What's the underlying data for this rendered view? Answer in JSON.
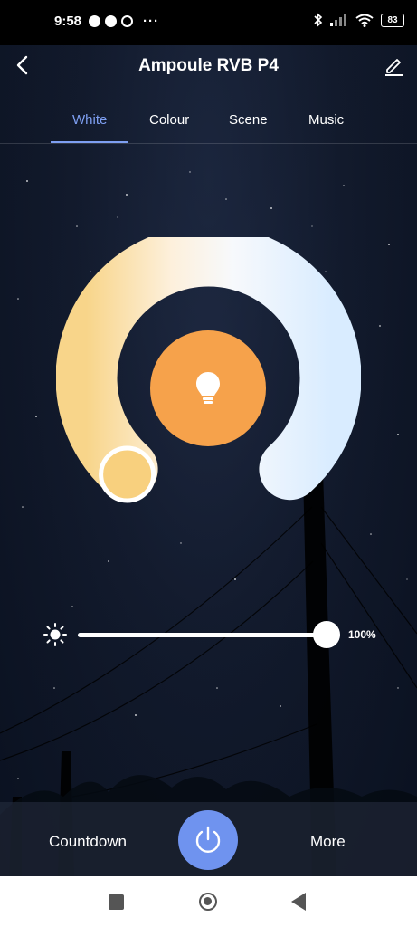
{
  "status_bar": {
    "time": "9:58",
    "overflow": "···",
    "battery": "83"
  },
  "header": {
    "title": "Ampoule RVB P4"
  },
  "tabs": [
    {
      "label": "White",
      "active": true
    },
    {
      "label": "Colour",
      "active": false
    },
    {
      "label": "Scene",
      "active": false
    },
    {
      "label": "Music",
      "active": false
    }
  ],
  "brightness": {
    "value_label": "100%",
    "level": 1.0
  },
  "bottom": {
    "countdown_label": "Countdown",
    "more_label": "More"
  },
  "colors": {
    "accent": "#7e9ff2",
    "bulb_orange": "#f6a24b",
    "power_blue": "#6f93ef",
    "warm": "#f8d58a",
    "cool": "#dceeff"
  },
  "icons": [
    "back-arrow-icon",
    "edit-pencil-icon",
    "lightbulb-icon",
    "sun-icon",
    "power-icon"
  ]
}
